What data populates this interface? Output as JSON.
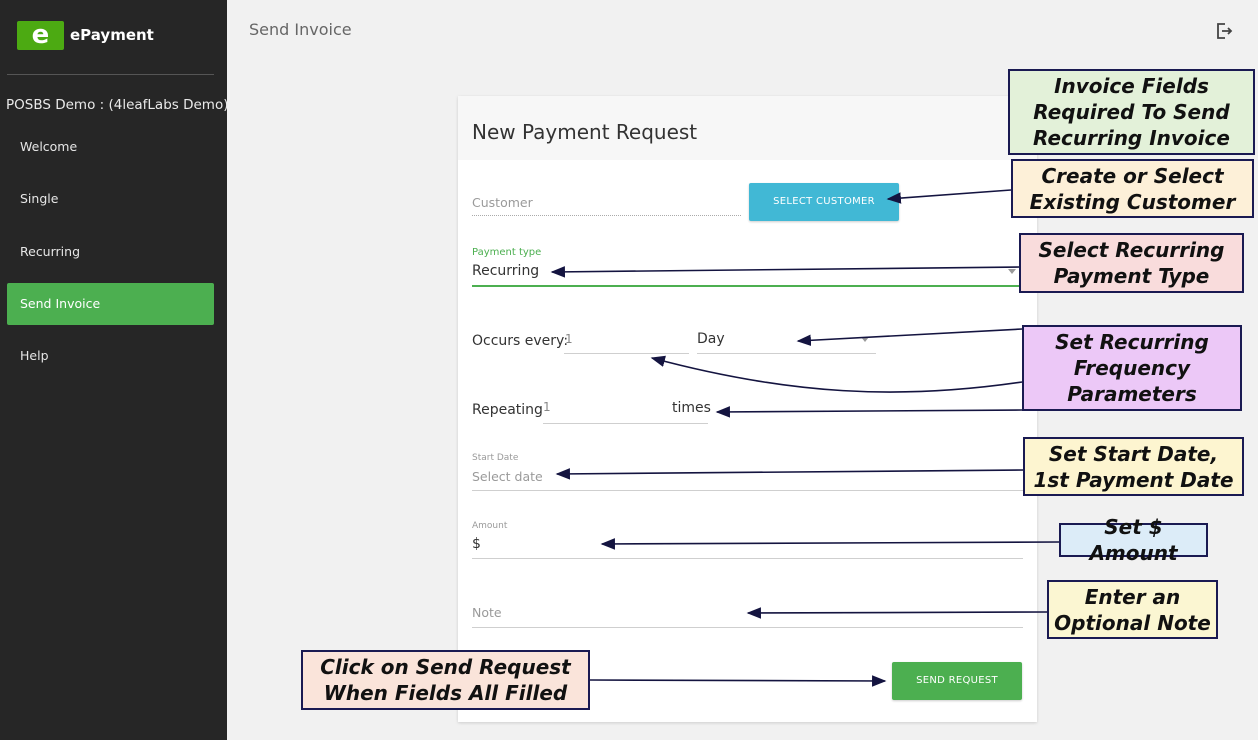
{
  "sidebar": {
    "logo_letter": "e",
    "brand": "ePayment",
    "account": "POSBS Demo : (4leafLabs Demo)",
    "items": [
      {
        "label": "Welcome"
      },
      {
        "label": "Single"
      },
      {
        "label": "Recurring"
      },
      {
        "label": "Send Invoice"
      },
      {
        "label": "Help"
      }
    ],
    "active_item": "Send Invoice"
  },
  "header": {
    "title": "Send Invoice",
    "logout_icon": "logout-icon"
  },
  "form": {
    "title": "New Payment Request",
    "customer_label": "Customer",
    "select_customer_button": "SELECT CUSTOMER",
    "payment_type_label": "Payment type",
    "payment_type_value": "Recurring",
    "occurs_every_label": "Occurs every:",
    "occurs_every_value": "1",
    "frequency_unit": "Day",
    "repeating_label": "Repeating",
    "repeating_value": "1",
    "repeating_suffix": "times",
    "start_date_label": "Start Date",
    "start_date_placeholder": "Select date",
    "amount_label": "Amount",
    "amount_prefix": "$",
    "note_placeholder": "Note",
    "send_button": "SEND REQUEST"
  },
  "callouts": {
    "required": "Invoice Fields\nRequired To Send\nRecurring Invoice",
    "customer": "Create or Select\nExisting Customer",
    "payment_type": "Select Recurring\nPayment Type",
    "frequency": "Set Recurring\nFrequency\nParameters",
    "start_date": "Set Start Date,\n1st Payment Date",
    "amount": "Set $ Amount",
    "note": "Enter an\nOptional Note",
    "send": "Click on Send Request\nWhen Fields All Filled"
  },
  "colors": {
    "sidebar_bg": "#262626",
    "accent_green": "#4caf50",
    "button_blue": "#41b8d5",
    "callout_green": "#e3f1d9",
    "callout_orange": "#fdf0d8",
    "callout_pink": "#f9dcdc",
    "callout_purple": "#ecc8f7",
    "callout_yellow": "#fdf5d0",
    "callout_blue": "#dcecf8",
    "callout_cream": "#fbf6d2",
    "callout_salmon": "#fae4da"
  }
}
